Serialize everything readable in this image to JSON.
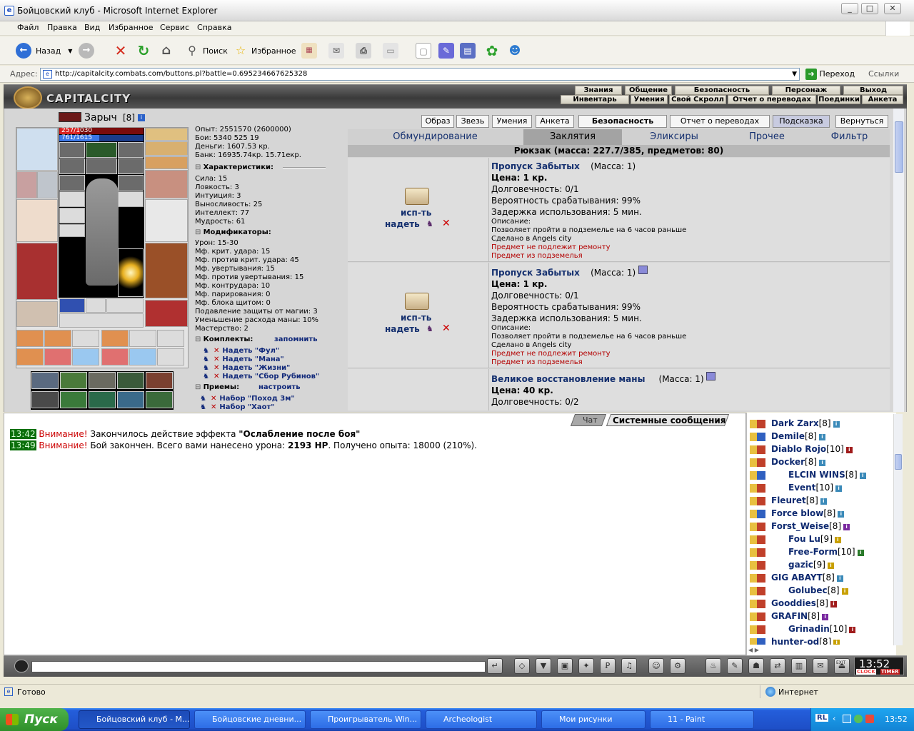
{
  "window": {
    "title": "Бойцовский клуб - Microsoft Internet Explorer",
    "min": "_",
    "max": "□",
    "close": "✕"
  },
  "menu": [
    "Файл",
    "Правка",
    "Вид",
    "Избранное",
    "Сервис",
    "Справка"
  ],
  "toolbar": {
    "back": "Назад",
    "search": "Поиск",
    "favorites": "Избранное"
  },
  "address": {
    "label": "Адрес:",
    "url": "http://capitalcity.combats.com/buttons.pl?battle=0.695234667625328",
    "go": "Переход",
    "links": "Ссылки"
  },
  "game": {
    "logo": "CAPITALCITY",
    "nav_top": [
      "Знания",
      "Общение",
      "Безопасность",
      "Персонаж",
      "Выход"
    ],
    "nav_bottom": [
      "Инвентарь",
      "Умения",
      "Свой Скролл",
      "Отчет о переводах",
      "Поединки",
      "Анкета"
    ]
  },
  "character": {
    "name": "Зарыч",
    "level": "[8]",
    "hp": "257/1030",
    "mana": "761/1615",
    "exp": "Опыт: 2551570 (2600000)",
    "fights": "Бои:   5340      525      19",
    "money": "Деньги: 1607.53 кр.",
    "bank": "Банк: 16935.74кр. 15.71екр.",
    "stats_title": "Характеристики:",
    "stats": [
      "Сила: 15",
      "Ловкость: 3",
      "Интуиция: 3",
      "Выносливость: 25",
      "Интеллект: 77",
      "Мудрость: 61"
    ],
    "mods_title": "Модификаторы:",
    "mods": [
      "Урон: 15-30",
      "Мф. крит. удара: 15",
      "Мф. против крит. удара: 45",
      "Мф. увертывания: 15",
      "Мф. против увертывания: 15",
      "Мф. контрудара: 10",
      "Мф. парирования: 0",
      "Мф. блока щитом: 0",
      "Подавление защиты от магии: 3",
      "Уменьшение расхода маны: 10%",
      "Мастерство: 2"
    ],
    "sets_title": "Комплекты:",
    "sets_action": "запомнить",
    "sets": [
      "Надеть \"Фул\"",
      "Надеть \"Мана\"",
      "Надеть \"Жизни\"",
      "Надеть \"Сбор Рубинов\""
    ],
    "tricks_title": "Приемы:",
    "tricks_action": "настроить",
    "tricks": [
      "Набор \"Поход 3м\"",
      "Набор \"Хаот\""
    ]
  },
  "buttons": [
    "Образ",
    "Звезь",
    "Умения",
    "Анкета",
    "Безопасность",
    "Отчет о переводах",
    "Подсказка",
    "Вернуться"
  ],
  "tabs": [
    "Обмундирование",
    "Заклятия",
    "Эликсиры",
    "Прочее",
    "Фильтр"
  ],
  "backpack": "Рюкзак (масса: 227.7/385, предметов: 80)",
  "items": [
    {
      "use": "исп-ть",
      "wear": "надеть",
      "name": "Пропуск Забытых",
      "mass": "(Масса: 1)",
      "price": "Цена: 1 кр.",
      "dur": "Долговечность: 0/1",
      "prob": "Вероятность срабатывания: 99%",
      "delay": "Задержка использования: 5 мин.",
      "desc_title": "Описание:",
      "desc": "Позволяет пройти в подземелье на 6 часов раньше",
      "made": "Сделано в Angels city",
      "note1": "Предмет не подлежит ремонту",
      "note2": "Предмет из подземелья"
    },
    {
      "use": "исп-ть",
      "wear": "надеть",
      "name": "Пропуск Забытых",
      "mass": "(Масса: 1)",
      "price": "Цена: 1 кр.",
      "dur": "Долговечность: 0/1",
      "prob": "Вероятность срабатывания: 99%",
      "delay": "Задержка использования: 5 мин.",
      "desc_title": "Описание:",
      "desc": "Позволяет пройти в подземелье на 6 часов раньше",
      "made": "Сделано в Angels city",
      "note1": "Предмет не подлежит ремонту",
      "note2": "Предмет из подземелья"
    },
    {
      "name": "Великое восстановление маны",
      "mass": "(Масса: 1)",
      "price": "Цена: 40 кр.",
      "dur": "Долговечность: 0/2"
    }
  ],
  "chat": {
    "tabs": [
      "Чат",
      "Системные сообщения"
    ],
    "messages": [
      {
        "time": "13:42",
        "warn": "Внимание!",
        "text": "Закончилось действие эффекта",
        "bold": "\"Ослабление после боя\"",
        "rest": ""
      },
      {
        "time": "13:49",
        "warn": "Внимание!",
        "text": "Бой закончен. Всего вами нанесено урона:",
        "bold": "2193 HP",
        "rest": ". Получено опыта: 18000 (210%)."
      }
    ]
  },
  "users": [
    {
      "name": "Dark Zarx",
      "lvl": "[8]"
    },
    {
      "name": "Demile",
      "lvl": "[8]"
    },
    {
      "name": "Diablo Rojo",
      "lvl": "[10]"
    },
    {
      "name": "Docker",
      "lvl": "[8]"
    },
    {
      "name": "ELCIN WINS",
      "lvl": "[8]"
    },
    {
      "name": "Event",
      "lvl": "[10]"
    },
    {
      "name": "Fleuret",
      "lvl": "[8]"
    },
    {
      "name": "Force blow",
      "lvl": "[8]"
    },
    {
      "name": "Forst_Weise",
      "lvl": "[8]"
    },
    {
      "name": "Fou Lu",
      "lvl": "[9]"
    },
    {
      "name": "Free-Form",
      "lvl": "[10]"
    },
    {
      "name": "gazic",
      "lvl": "[9]"
    },
    {
      "name": "GIG ABAYT",
      "lvl": "[8]"
    },
    {
      "name": "Golubec",
      "lvl": "[8]"
    },
    {
      "name": "Gooddies",
      "lvl": "[8]"
    },
    {
      "name": "GRAFIN",
      "lvl": "[8]"
    },
    {
      "name": "Grinadin",
      "lvl": "[10]"
    },
    {
      "name": "hunter-od",
      "lvl": "[8]"
    }
  ],
  "clock": {
    "time": "13:52",
    "label1": "CLOCK",
    "label2": "TIMER",
    "exit": "EXIT"
  },
  "status": {
    "text": "Готово",
    "zone": "Интернет"
  },
  "taskbar": {
    "start": "Пуск",
    "tasks": [
      "Бойцовский клуб - М...",
      "Бойцовские дневни...",
      "Проигрыватель Win...",
      "Archeologist",
      "Мои рисунки",
      "11 - Paint"
    ],
    "lang": "RL",
    "time": "13:52"
  }
}
